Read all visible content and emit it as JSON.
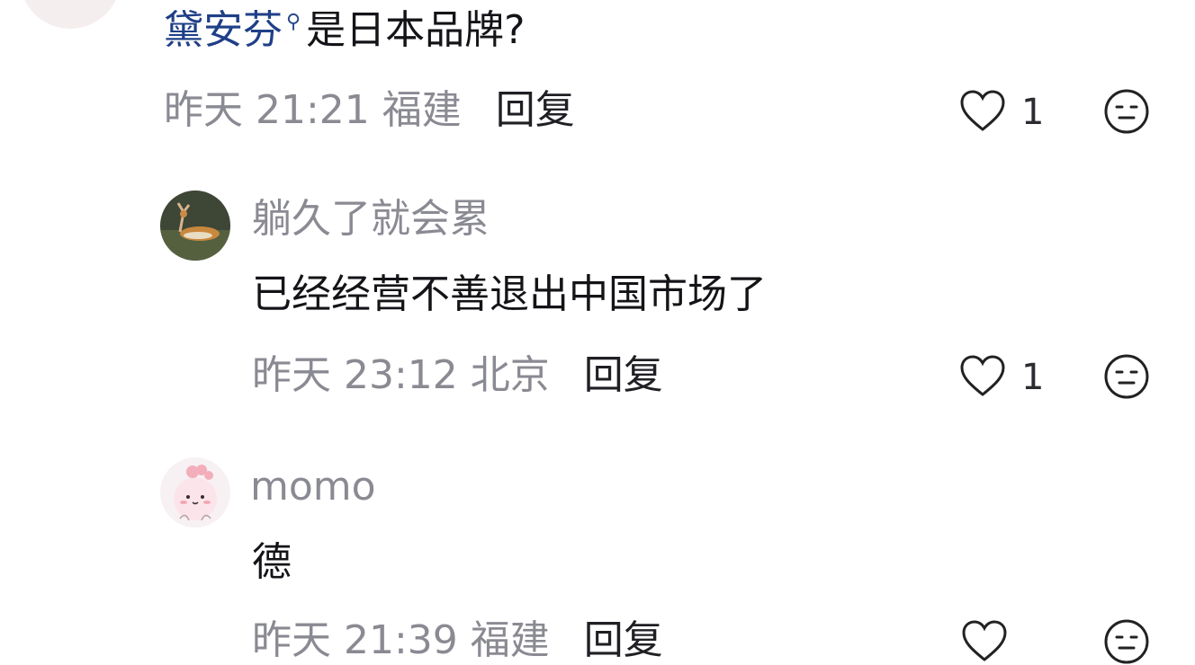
{
  "comments": [
    {
      "text_link": "黛安芬",
      "text_rest": "是日本品牌?",
      "time": "昨天 21:21 福建",
      "reply_label": "回复",
      "likes": "1"
    },
    {
      "username": "躺久了就会累",
      "text": "已经经营不善退出中国市场了",
      "time": "昨天 23:12 北京",
      "reply_label": "回复",
      "likes": "1"
    },
    {
      "username": "momo",
      "text": "德",
      "time": "昨天 21:39 福建",
      "reply_label": "回复"
    }
  ],
  "colors": {
    "link": "#1f3f87",
    "meta": "#8a8a93",
    "text": "#141418"
  },
  "icons": [
    "heart-icon",
    "emoji-icon",
    "search-icon"
  ]
}
